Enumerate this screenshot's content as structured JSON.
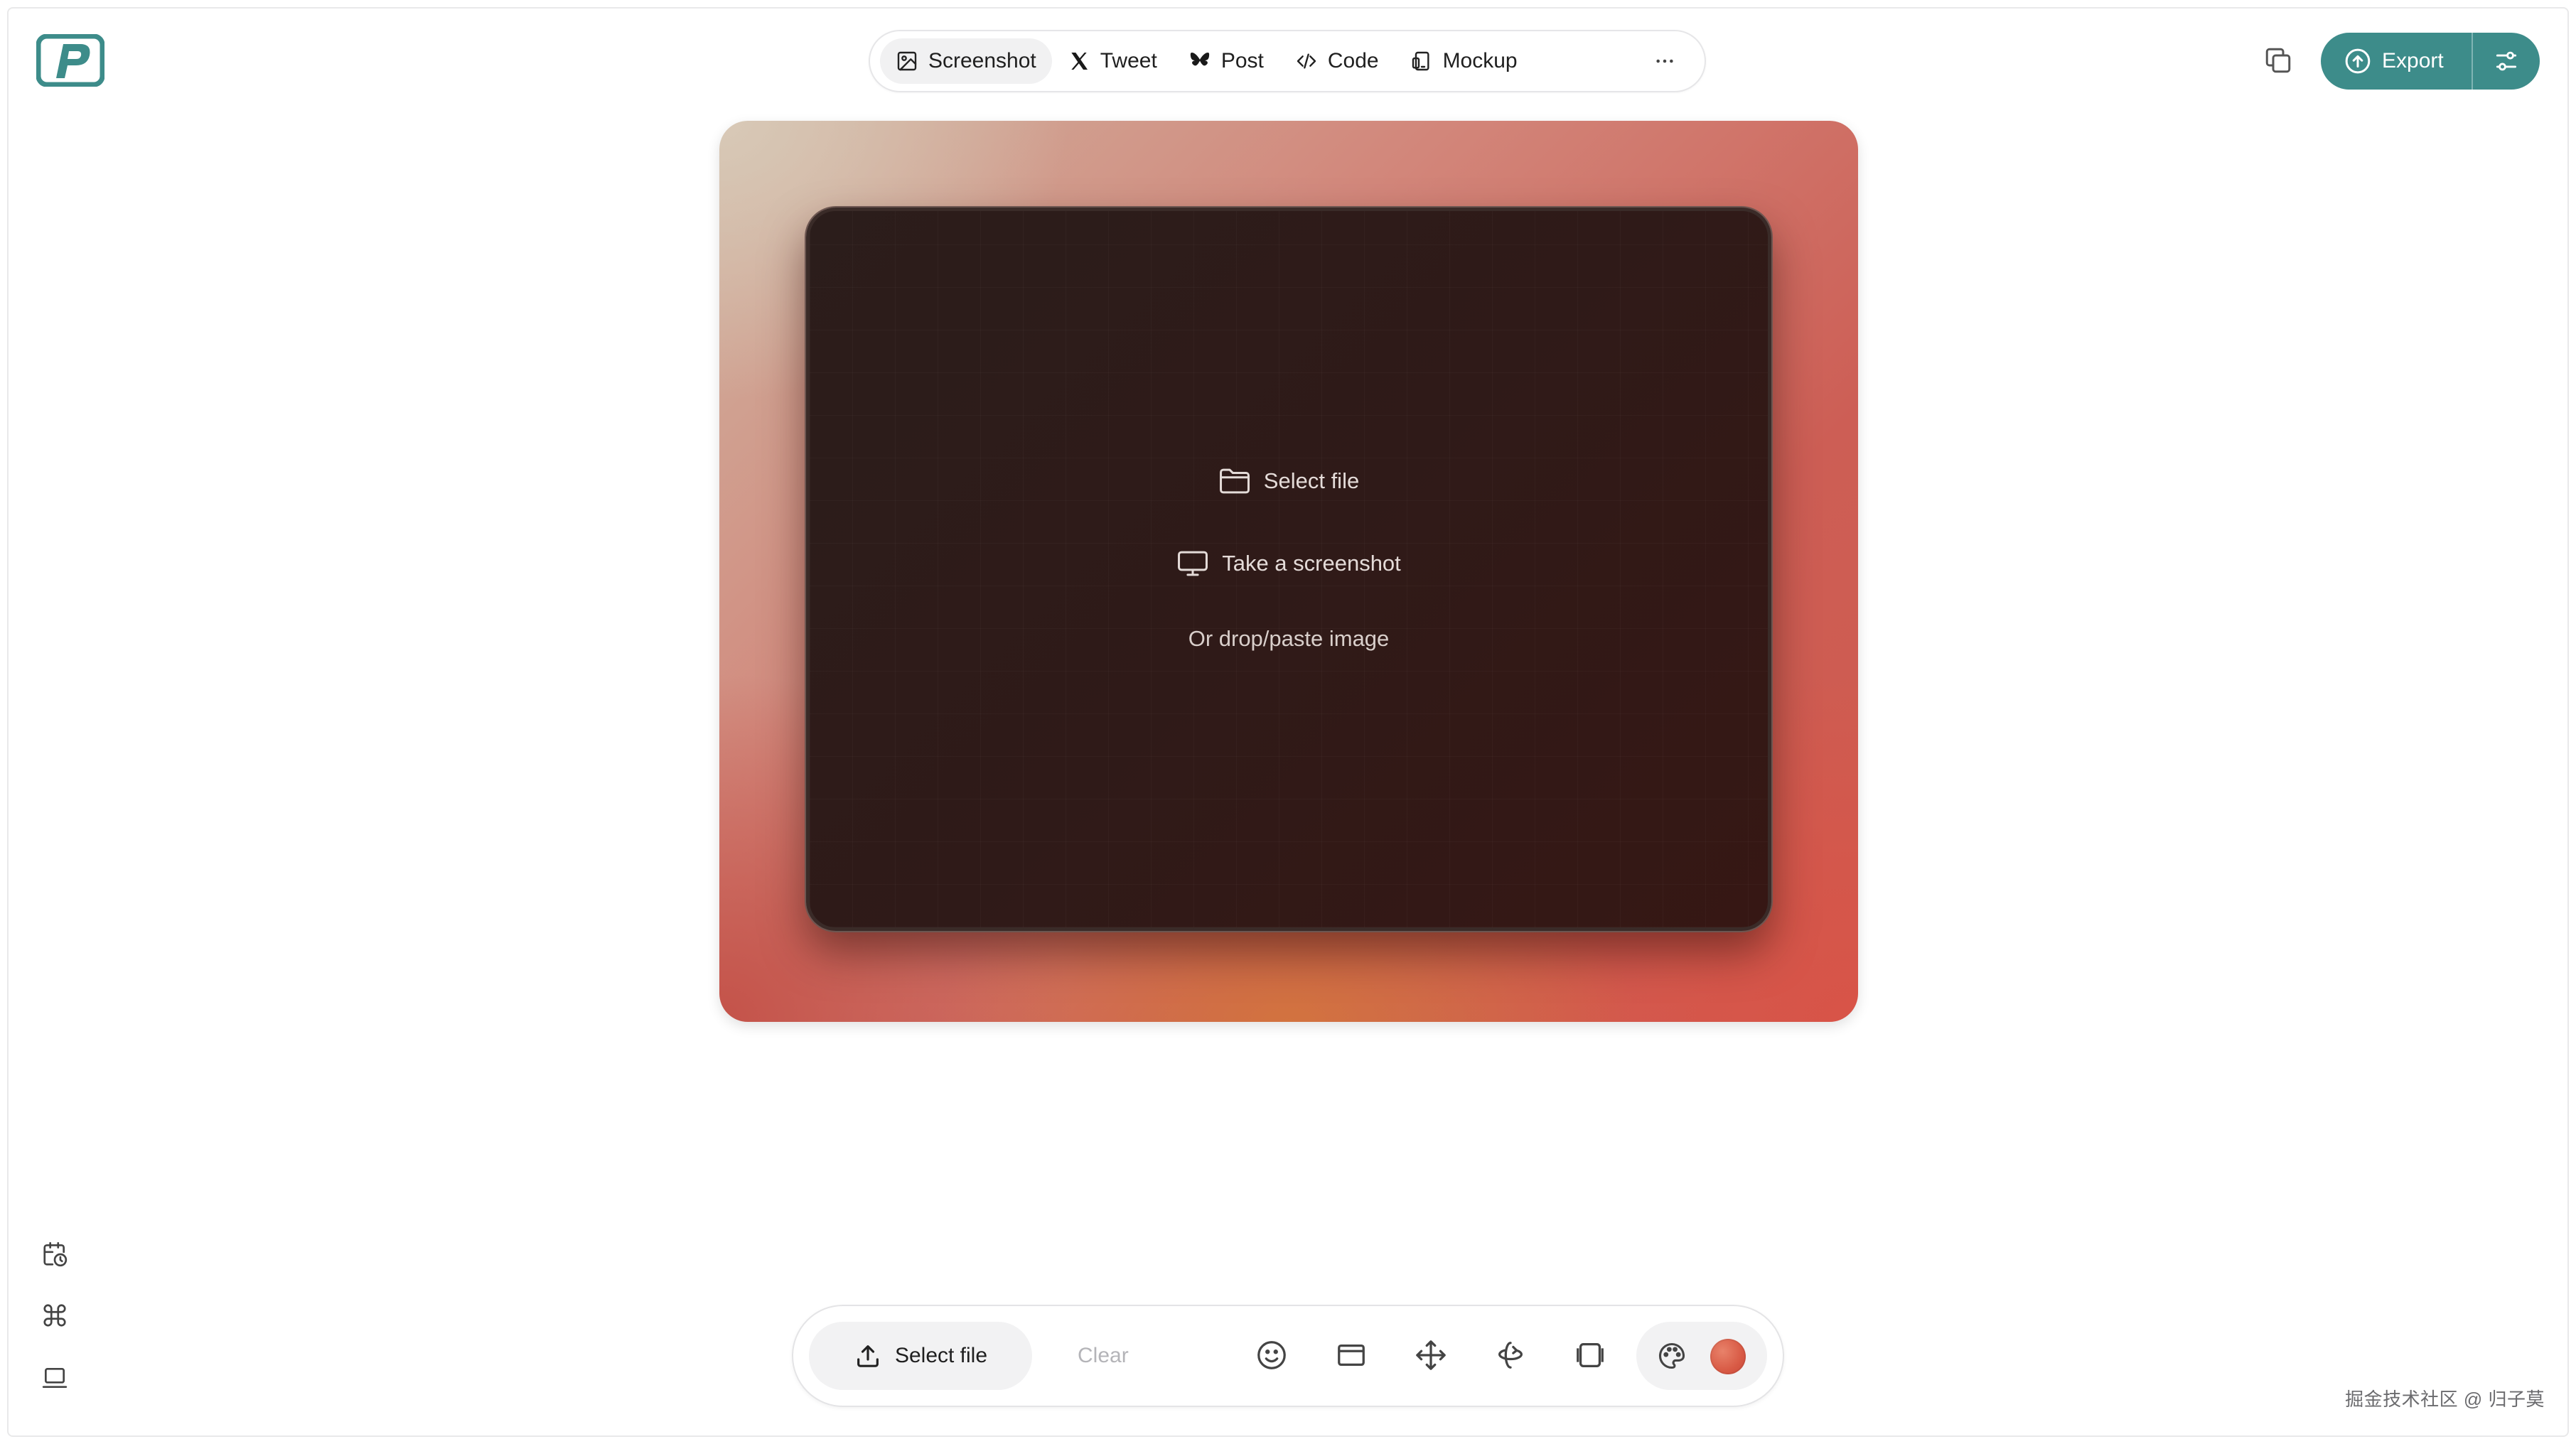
{
  "topnav": {
    "tabs": [
      {
        "label": "Screenshot",
        "icon": "image-icon",
        "active": true
      },
      {
        "label": "Tweet",
        "icon": "x-logo-icon",
        "active": false
      },
      {
        "label": "Post",
        "icon": "butterfly-icon",
        "active": false
      },
      {
        "label": "Code",
        "icon": "code-icon",
        "active": false
      },
      {
        "label": "Mockup",
        "icon": "device-icon",
        "active": false
      }
    ],
    "more_icon": "ellipsis-icon"
  },
  "header_right": {
    "export_label": "Export",
    "accent_color": "#3d8c8a"
  },
  "canvas": {
    "select_file": "Select file",
    "take_screenshot": "Take a screenshot",
    "drop_hint": "Or drop/paste image"
  },
  "sidebar": {
    "icons": [
      "calendar-clock-icon",
      "command-icon",
      "laptop-icon"
    ]
  },
  "toolbar": {
    "select_file": "Select file",
    "clear": "Clear",
    "icons": [
      "smile-icon",
      "window-frame-icon",
      "move-icon",
      "rotate-3d-icon",
      "layers-icon",
      "palette-icon"
    ],
    "swatch_color": "#d85a45"
  },
  "watermark": "掘金技术社区 @ 归子莫"
}
